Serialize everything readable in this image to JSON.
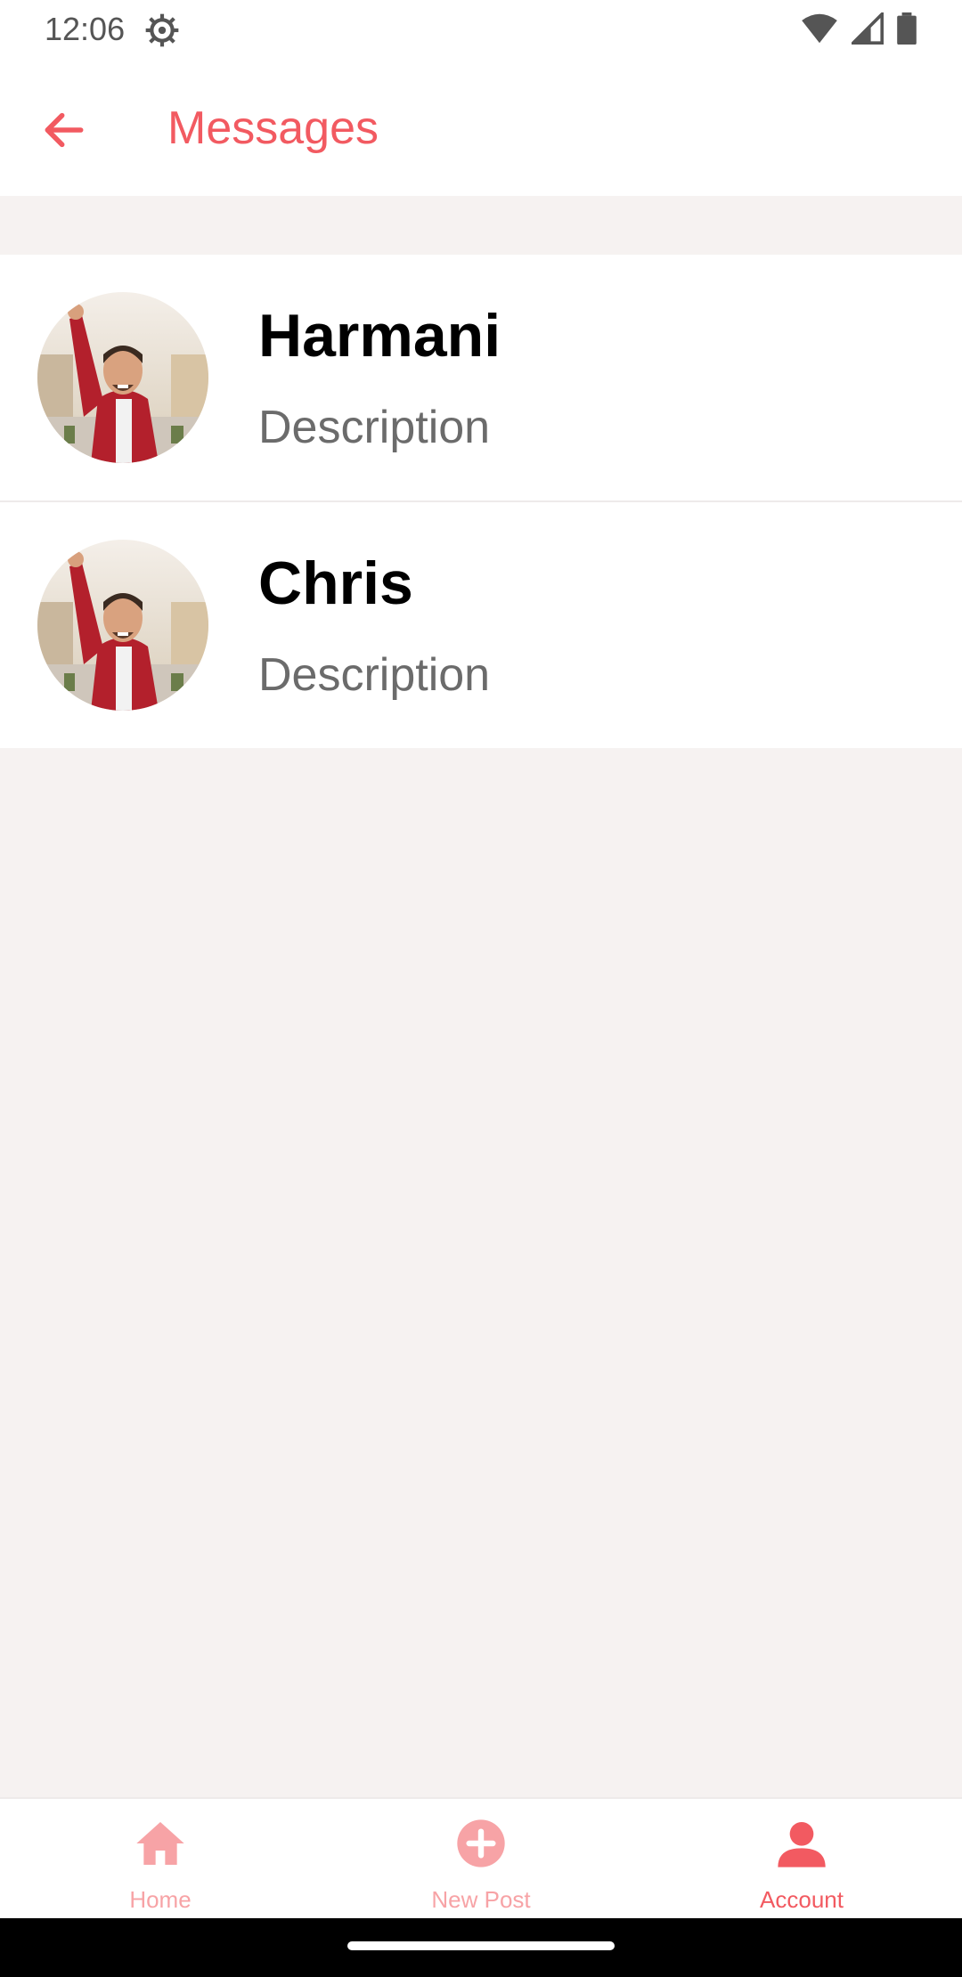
{
  "status_bar": {
    "time": "12:06",
    "icons": [
      "settings-icon",
      "wifi-icon",
      "signal-icon",
      "battery-icon"
    ]
  },
  "app_bar": {
    "title": "Messages",
    "back_icon": "arrow-left-icon"
  },
  "conversations": [
    {
      "name": "Harmani",
      "description": "Description",
      "avatar": "avatar-photo"
    },
    {
      "name": "Chris",
      "description": "Description",
      "avatar": "avatar-photo"
    }
  ],
  "bottom_nav": {
    "items": [
      {
        "label": "Home",
        "icon": "home-icon",
        "active": false
      },
      {
        "label": "New Post",
        "icon": "add-circle-icon",
        "active": false
      },
      {
        "label": "Account",
        "icon": "person-icon",
        "active": true
      }
    ]
  },
  "colors": {
    "accent": "#f25a61",
    "accent_light": "#f7a3a6",
    "background": "#f6f2f1"
  }
}
